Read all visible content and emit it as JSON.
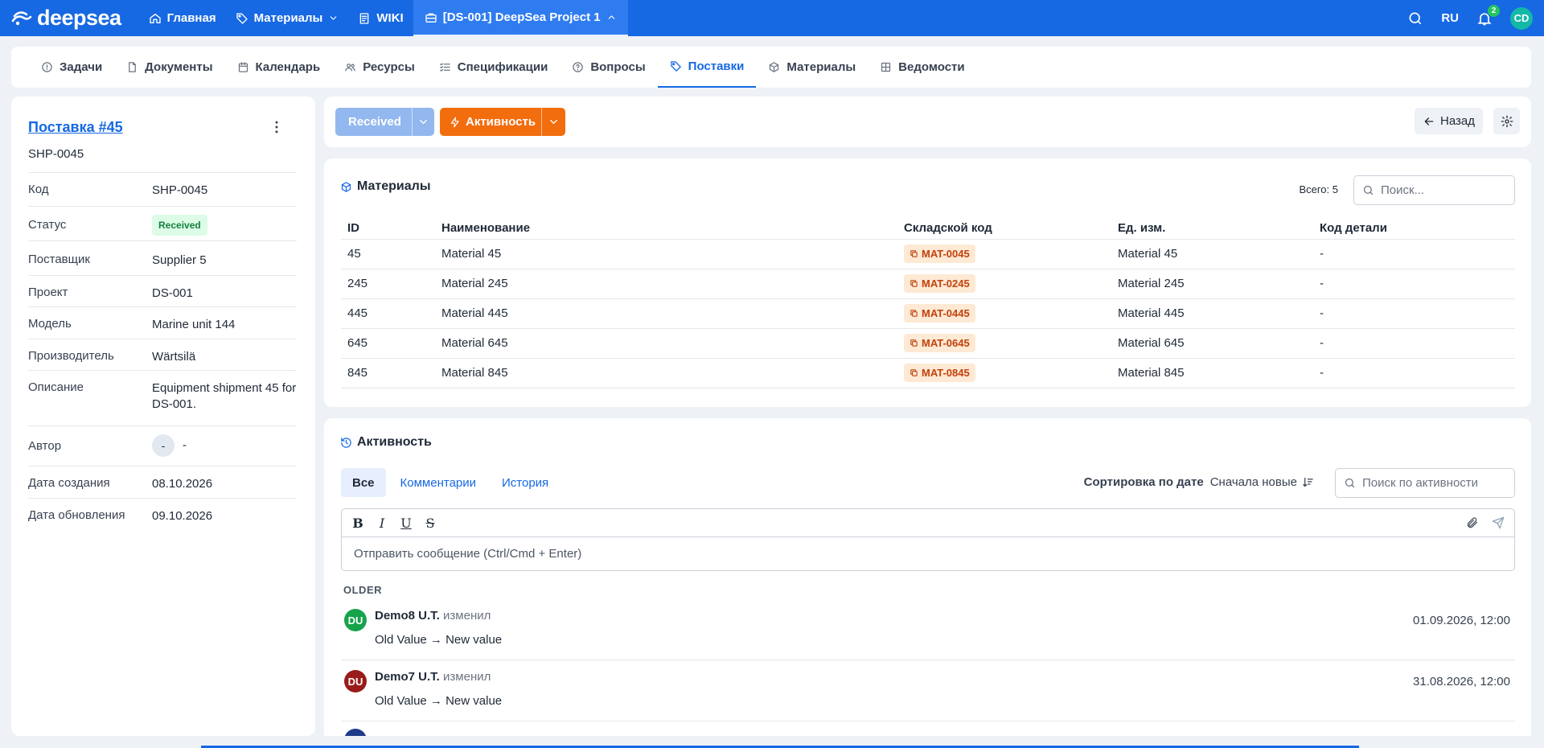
{
  "brand": {
    "name": "deepsea"
  },
  "topnav": {
    "home": "Главная",
    "materials": "Материалы",
    "wiki": "WIKI",
    "project": "[DS-001] DeepSea Project 1",
    "lang": "RU",
    "notifications": "2",
    "user_initials": "CD"
  },
  "tabs": [
    "Задачи",
    "Документы",
    "Календарь",
    "Ресурсы",
    "Спецификации",
    "Вопросы",
    "Поставки",
    "Материалы",
    "Ведомости"
  ],
  "shipment": {
    "title": "Поставка #45",
    "subtitle": "SHP-0045",
    "props": {
      "code_label": "Код",
      "code": "SHP-0045",
      "status_label": "Статус",
      "status": "Received",
      "supplier_label": "Поставщик",
      "supplier": "Supplier 5",
      "project_label": "Проект",
      "project": "DS-001",
      "model_label": "Модель",
      "model": "Marine unit 144",
      "manufacturer_label": "Производитель",
      "manufacturer": "Wärtsilä",
      "description_label": "Описание",
      "description": "Equipment shipment 45 for DS-001.",
      "author_label": "Автор",
      "author_initial": "-",
      "author": "-",
      "created_label": "Дата создания",
      "created": "08.10.2026",
      "updated_label": "Дата обновления",
      "updated": "09.10.2026"
    }
  },
  "actions": {
    "status_button": "Received",
    "activity_button": "Активность",
    "back": "Назад"
  },
  "materials": {
    "title": "Материалы",
    "total": "Всего: 5",
    "search_placeholder": "Поиск...",
    "columns": [
      "ID",
      "Наименование",
      "Складской код",
      "Ед. изм.",
      "Код детали"
    ],
    "rows": [
      {
        "id": "45",
        "name": "Material 45",
        "code": "MAT-0045",
        "unit": "Material 45",
        "part": "-"
      },
      {
        "id": "245",
        "name": "Material 245",
        "code": "MAT-0245",
        "unit": "Material 245",
        "part": "-"
      },
      {
        "id": "445",
        "name": "Material 445",
        "code": "MAT-0445",
        "unit": "Material 445",
        "part": "-"
      },
      {
        "id": "645",
        "name": "Material 645",
        "code": "MAT-0645",
        "unit": "Material 645",
        "part": "-"
      },
      {
        "id": "845",
        "name": "Material 845",
        "code": "MAT-0845",
        "unit": "Material 845",
        "part": "-"
      }
    ]
  },
  "activity": {
    "title": "Активность",
    "tabs": [
      "Все",
      "Комментарии",
      "История"
    ],
    "sort_label": "Сортировка по дате",
    "sort_value": "Сначала новые",
    "search_placeholder": "Поиск по активности",
    "editor_placeholder": "Отправить сообщение (Ctrl/Cmd + Enter)",
    "group": "OLDER",
    "entries": [
      {
        "initials": "DU",
        "user": "Demo8 U.T.",
        "action": "изменил",
        "change": "Old Value → New value",
        "date": "01.09.2026, 12:00",
        "color": "#16a34a"
      },
      {
        "initials": "DU",
        "user": "Demo7 U.T.",
        "action": "изменил",
        "change": "Old Value → New value",
        "date": "31.08.2026, 12:00",
        "color": "#991b1b"
      }
    ]
  },
  "colors": {
    "primary": "#1668e3",
    "accent": "#f26d0e",
    "success": "#15803d"
  }
}
